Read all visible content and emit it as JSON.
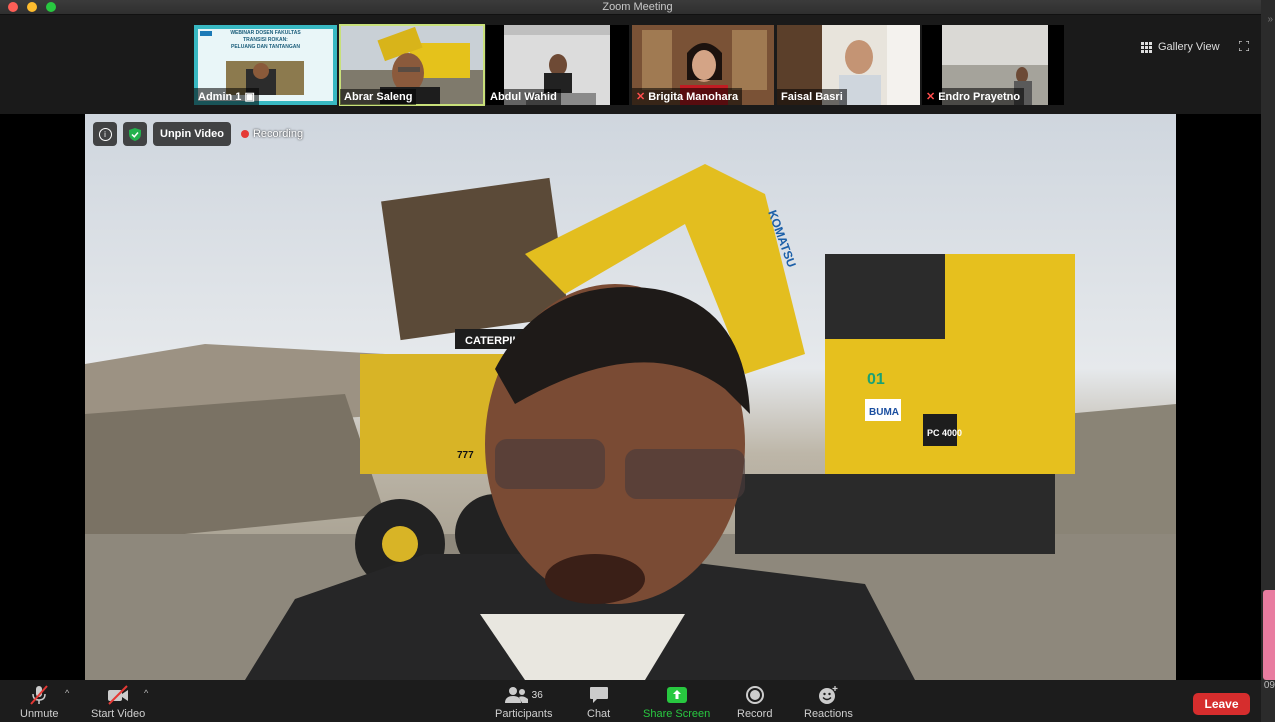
{
  "window": {
    "title": "Zoom Meeting"
  },
  "gallery": {
    "view_label": "Gallery View",
    "tiles": [
      {
        "name": "Admin 1",
        "slide_lines": [
          "WEBINAR DOSEN FAKULTAS",
          "TRANSISI ROKAN:",
          "PELUANG DAN TANTANGAN"
        ]
      },
      {
        "name": "Abrar Saleng"
      },
      {
        "name": "Abdul Wahid"
      },
      {
        "name": "Brigita Manohara"
      },
      {
        "name": "Faisal Basri"
      },
      {
        "name": "Endro Prayetno"
      }
    ]
  },
  "video": {
    "unpin_label": "Unpin Video",
    "recording_label": "Recording",
    "truck_brand": "CATERPILLAR",
    "truck_number": "777",
    "excavator_brand": "KOMATSU",
    "excavator_unit": "01",
    "excavator_owner": "BUMA",
    "excavator_model": "PC 4000"
  },
  "toolbar": {
    "unmute": "Unmute",
    "start_video": "Start Video",
    "participants": "Participants",
    "participants_count": "36",
    "chat": "Chat",
    "share_screen": "Share Screen",
    "record": "Record",
    "reactions": "Reactions",
    "leave": "Leave"
  },
  "edge": {
    "partial_number": "09"
  },
  "colors": {
    "leave": "#d62d2d",
    "share_green": "#28c840",
    "recording_red": "#e53935",
    "active_tile": "#c8e07a"
  }
}
